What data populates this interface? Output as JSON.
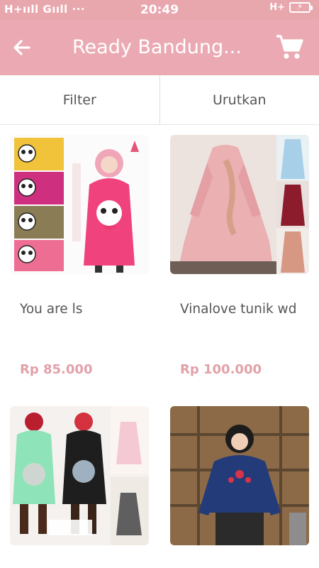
{
  "status_bar": {
    "network_left": "H+ııll Gııll ···",
    "time": "20:49",
    "network_right": "H+"
  },
  "toolbar": {
    "back_icon": "arrow-left-icon",
    "title": "Ready Bandung...",
    "cart_icon": "shopping-cart-icon"
  },
  "controls": {
    "filter_label": "Filter",
    "sort_label": "Urutkan"
  },
  "products": [
    {
      "name": "You are ls",
      "price": "Rp 85.000"
    },
    {
      "name": "Vinalove tunik wd",
      "price": "Rp 100.000"
    },
    {
      "name": "",
      "price": ""
    },
    {
      "name": "",
      "price": ""
    }
  ],
  "colors": {
    "brand": "#ebaab3",
    "status_bar": "#e8a6ad",
    "price": "#e2a1a9"
  }
}
